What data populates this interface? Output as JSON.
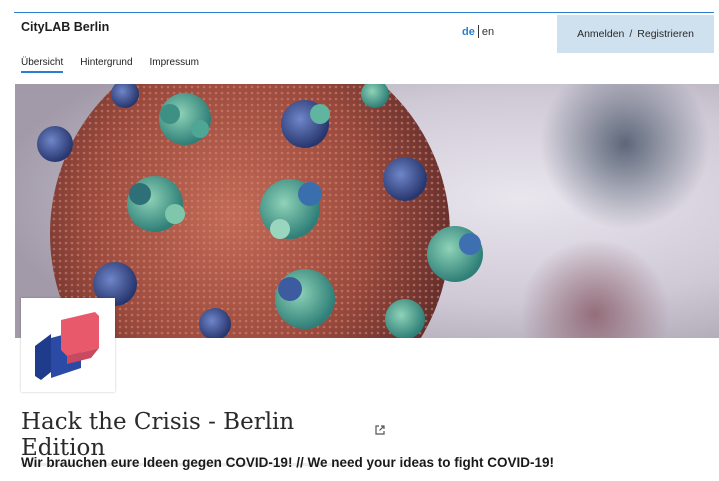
{
  "header": {
    "brand": "CityLAB Berlin",
    "lang_active": "de",
    "lang_other": "en",
    "login_label": "Anmelden",
    "auth_separator": "/",
    "register_label": "Registrieren"
  },
  "nav": {
    "tabs": [
      {
        "label": "Übersicht",
        "active": true
      },
      {
        "label": "Hintergrund",
        "active": false
      },
      {
        "label": "Impressum",
        "active": false
      }
    ]
  },
  "hero": {
    "image": "coronavirus-illustration"
  },
  "project": {
    "logo": "citylab-logo",
    "title": "Hack the Crisis - Berlin Edition",
    "title_icon": "external-link-icon",
    "tagline": "Wir brauchen eure Ideen gegen COVID-19! // We need your ideas to fight COVID-19!"
  },
  "colors": {
    "accent": "#2b7fd0",
    "auth_bg": "#cfe0ee",
    "logo_navy": "#1f3b8c",
    "logo_pink": "#e8596c"
  }
}
